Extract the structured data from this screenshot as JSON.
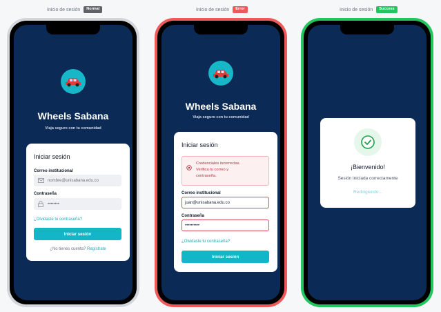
{
  "captions": [
    {
      "label": "Inicio de sesión",
      "badge": "Normal",
      "color": "#5f6368"
    },
    {
      "label": "Inicio de sesión",
      "badge": "Error",
      "color": "#ee5a5a"
    },
    {
      "label": "Inicio de sesión",
      "badge": "Success",
      "color": "#22c55e"
    }
  ],
  "frames": {
    "normal": "#d3d6da",
    "error": "#ee5a5a",
    "success": "#22c55e"
  },
  "colors": {
    "screen_bg": "#0b2a56",
    "accent": "#13b6c6",
    "error": "#dc4a5a"
  },
  "app": {
    "title": "Wheels Sabana",
    "subtitle": "Viaja seguro con tu comunidad",
    "logo_icon": "car-icon"
  },
  "login": {
    "heading": "Iniciar sesión",
    "email_label": "Correo institucional",
    "email_placeholder": "nombre@unisabana.edu.co",
    "password_label": "Contraseña",
    "password_placeholder": "••••••••",
    "forgot": "¿Olvidaste tu contraseña?",
    "submit": "Iniciar sesión",
    "no_account": "¿No tienes cuenta?",
    "register": "Regístrate"
  },
  "error_state": {
    "message": [
      "Credenciales incorrectas.",
      "Verifica tu correo y",
      "contraseña."
    ],
    "email_value": "juan@unisabana.edu.co",
    "password_value": "••••••••••"
  },
  "success_state": {
    "title": "¡Bienvenido!",
    "subtitle": "Sesión iniciada correctamente",
    "redirect": "Redirigiendo..."
  }
}
